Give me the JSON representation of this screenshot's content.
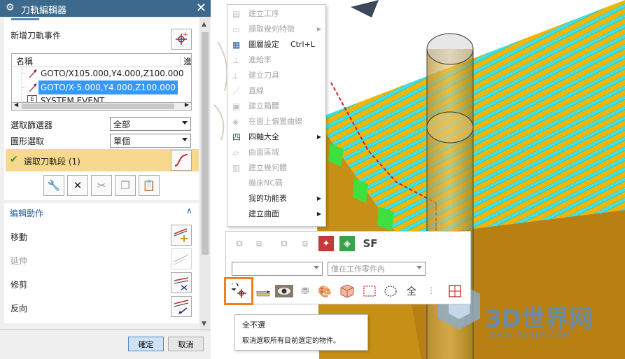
{
  "dialog": {
    "title": "刀軌編輯器",
    "add_event_label": "新增刀軌事件",
    "tree": {
      "col_name": "名稱",
      "col_progress": "進",
      "rows": [
        "GOTO/X105.000,Y4.000,Z100.000",
        "GOTO/X-5.000,Y4.000,Z100.000",
        "SYSTEM EVENT"
      ],
      "selected_index": 1
    },
    "filter_label": "選取篩選器",
    "filter_value": "全部",
    "shape_label": "圖形選取",
    "shape_value": "單個",
    "select_segment_label": "選取刀軌段 (1)",
    "edit_section_title": "編輯動作",
    "actions": [
      {
        "label": "移動",
        "enabled": true
      },
      {
        "label": "延伸",
        "enabled": false
      },
      {
        "label": "修剪",
        "enabled": true
      },
      {
        "label": "反向",
        "enabled": true
      }
    ],
    "ok_label": "確定",
    "cancel_label": "取消"
  },
  "context_menu": {
    "items": [
      {
        "label": "建立工序",
        "enabled": false,
        "submenu": false,
        "shortcut": "",
        "icon": "operation-icon"
      },
      {
        "label": "擷取幾何特徵",
        "enabled": false,
        "submenu": true,
        "shortcut": "",
        "icon": "extract-geometry-icon"
      },
      {
        "label": "圖層設定",
        "enabled": true,
        "submenu": false,
        "shortcut": "Ctrl+L",
        "icon": "layer-settings-icon"
      },
      {
        "label": "進給率",
        "enabled": false,
        "submenu": false,
        "shortcut": "",
        "icon": "feed-rate-icon"
      },
      {
        "label": "建立刀具",
        "enabled": false,
        "submenu": false,
        "shortcut": "",
        "icon": "create-tool-icon"
      },
      {
        "label": "直線",
        "enabled": false,
        "submenu": false,
        "shortcut": "",
        "icon": "line-icon"
      },
      {
        "label": "建立箱體",
        "enabled": false,
        "submenu": false,
        "shortcut": "",
        "icon": "box-icon"
      },
      {
        "label": "在面上偏置曲線",
        "enabled": false,
        "submenu": false,
        "shortcut": "",
        "icon": "offset-curve-icon"
      },
      {
        "label": "四軸大全",
        "enabled": true,
        "submenu": true,
        "shortcut": "",
        "icon": "four-axis-icon"
      },
      {
        "label": "曲面區域",
        "enabled": false,
        "submenu": false,
        "shortcut": "",
        "icon": "surface-area-icon"
      },
      {
        "label": "建立幾何體",
        "enabled": false,
        "submenu": false,
        "shortcut": "",
        "icon": "create-geometry-icon"
      },
      {
        "label": "機床NC碼",
        "enabled": false,
        "submenu": false,
        "shortcut": "",
        "icon": ""
      },
      {
        "label": "我的功能表",
        "enabled": true,
        "submenu": true,
        "shortcut": "",
        "icon": ""
      },
      {
        "label": "建立曲面",
        "enabled": true,
        "submenu": true,
        "shortcut": "",
        "icon": ""
      }
    ]
  },
  "toolbar": {
    "sf_label": "SF",
    "scope_value": "僅在工作零件內",
    "filter_value": "",
    "all_label": "全"
  },
  "tooltip": {
    "title": "全不選",
    "description": "取消選取所有目前選定的物件。"
  },
  "watermark": {
    "brand": "3D世界网",
    "url": "WWW.3DSJW.COM"
  },
  "colors": {
    "title_bar": "#3d6a8c",
    "highlight_row": "#f6d98d",
    "tree_selection": "#3399ff",
    "stripe_cyan": "#2ad4d4",
    "stripe_yellow": "#f5b400",
    "stock_brown": "#b88012",
    "accent_orange": "#f0821e"
  }
}
